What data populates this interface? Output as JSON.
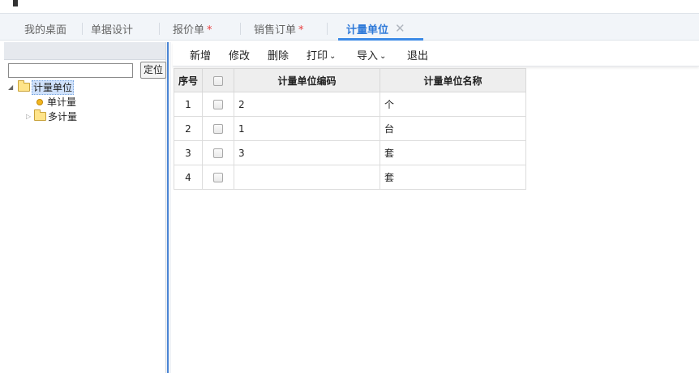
{
  "tabs": [
    {
      "label": "我的桌面",
      "modified": false
    },
    {
      "label": "单据设计",
      "modified": false
    },
    {
      "label": "报价单",
      "modified": true
    },
    {
      "label": "销售订单",
      "modified": true
    },
    {
      "label": "计量单位",
      "modified": false,
      "active": true
    }
  ],
  "tab_star": "*",
  "tab_close": "✕",
  "left": {
    "search_value": "",
    "locate_label": "定位",
    "tree": {
      "root": "计量单位",
      "children": [
        {
          "label": "单计量",
          "type": "leaf"
        },
        {
          "label": "多计量",
          "type": "folder",
          "expanded": false
        }
      ]
    }
  },
  "toolbar": {
    "add": "新增",
    "edit": "修改",
    "delete": "删除",
    "print": "打印",
    "import": "导入",
    "exit": "退出"
  },
  "grid": {
    "headers": {
      "seq": "序号",
      "code": "计量单位编码",
      "name": "计量单位名称"
    },
    "rows": [
      {
        "seq": "1",
        "code": "2",
        "name": "个"
      },
      {
        "seq": "2",
        "code": "1",
        "name": "台"
      },
      {
        "seq": "3",
        "code": "3",
        "name": "套"
      },
      {
        "seq": "4",
        "code": "",
        "name": "套"
      }
    ]
  },
  "colors": {
    "accent": "#3c8ae6",
    "tab_active_text": "#2f7ad9",
    "modified_star": "#e84040"
  }
}
